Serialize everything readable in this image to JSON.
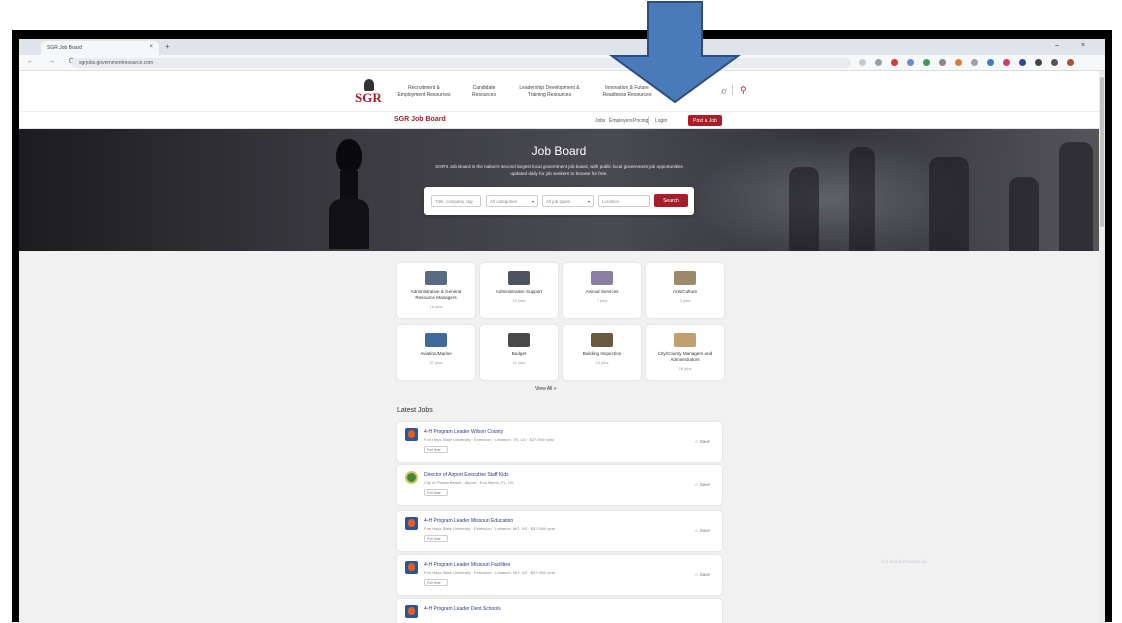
{
  "browser": {
    "tab_title": "SGR Job Board",
    "tab_close": "×",
    "new_tab": "+",
    "url": "sgrjobs.governmentresource.com",
    "window_controls": "– ×",
    "nav": "← → C"
  },
  "header": {
    "logo": "SGR",
    "menu": [
      {
        "label": "Recruitment & Employment Resources",
        "line1": "Recruitment &",
        "line2": "Employment Resources"
      },
      {
        "label": "Candidate Resources",
        "line1": "Candidate",
        "line2": "Resources"
      },
      {
        "label": "Leadership Development & Training Resources",
        "line1": "Leadership Development &",
        "line2": "Training Resources"
      },
      {
        "label": "Innovation & Future Readiness Resources",
        "line1": "Innovation & Future",
        "line2": "Readiness Resources"
      }
    ],
    "cart_icon": "cart-icon",
    "search_icon": "search-icon"
  },
  "subnav": {
    "title": "SGR Job Board",
    "links": [
      "Jobs",
      "Employers",
      "Pricing",
      "Login"
    ],
    "post_button": "Post a Job"
  },
  "hero": {
    "title": "Job Board",
    "description": "SGR's Job Board is the nation's second largest local government job board, with public local government job opportunities updated daily for job seekers to browse for free.",
    "search": {
      "keyword_placeholder": "Title, company, tag",
      "category": "All categories",
      "job_type": "All job types",
      "location_placeholder": "Location",
      "button": "Search"
    }
  },
  "categories": [
    {
      "name": "Administrative & General Resource Managers",
      "count": "16 jobs",
      "color": "#5a6a80"
    },
    {
      "name": "Administrative Support",
      "count": "10 jobs",
      "color": "#4a5560"
    },
    {
      "name": "Animal Services",
      "count": "7 jobs",
      "color": "#8a7fa0"
    },
    {
      "name": "Arts/Culture",
      "count": "3 jobs",
      "color": "#9c8a6a"
    },
    {
      "name": "Aviation/Marine",
      "count": "27 jobs",
      "color": "#3c6a9a"
    },
    {
      "name": "Budget",
      "count": "11 jobs",
      "color": "#4a4a4a"
    },
    {
      "name": "Building Inspection",
      "count": "15 jobs",
      "color": "#6a5a40"
    },
    {
      "name": "City/County Managers and Administrators",
      "count": "26 jobs",
      "color": "#c0a070"
    }
  ],
  "view_all": "View All »",
  "latest_title": "Latest Jobs",
  "jobs": [
    {
      "title": "4-H Program Leader Wilson County",
      "meta": "Fort Hays State University · Extension · Lebanon, TN, US · $37,000/ year",
      "tag": "Full time",
      "save": "☆ Save"
    },
    {
      "title": "Director of Airport Executive Staff Kids",
      "meta": "City of Florida Beach · Airport · Fort Myers, FL, US",
      "tag": "Full time",
      "save": "☆ Save"
    },
    {
      "title": "4-H Program Leader Missouri Education",
      "meta": "Fort Hays State University · Extension · Lebanon, MO, US · $37,000/ year",
      "tag": "Full time",
      "save": "☆ Save"
    },
    {
      "title": "4-H Program Leader Missouri Facilities",
      "meta": "Fort Hays State University · Extension · Lebanon, MO, US · $37,000/ year",
      "tag": "Full time",
      "save": "☆ Save"
    },
    {
      "title": "4-H Program Leader Dent Schools",
      "meta": "",
      "tag": "",
      "save": ""
    }
  ],
  "ghost_text": "Job Board Powered by",
  "colors": {
    "brand": "#a71d2a",
    "arrow": "#4a7ab8"
  }
}
